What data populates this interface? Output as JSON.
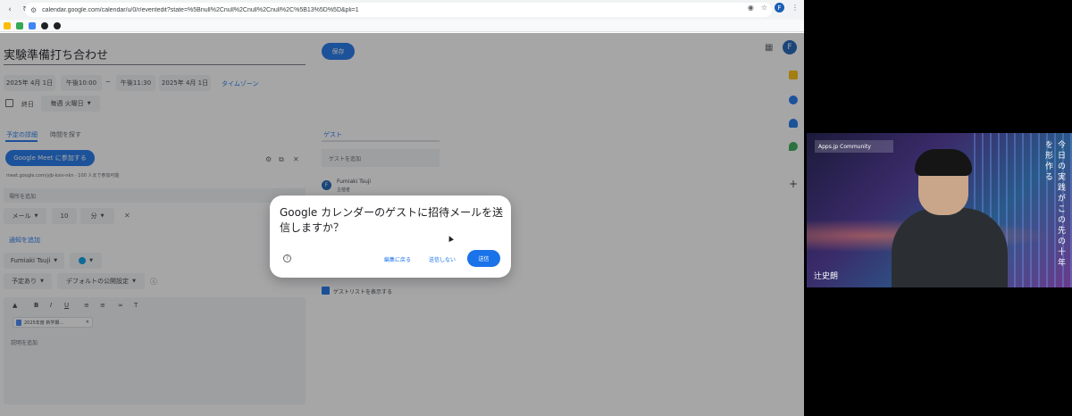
{
  "browser": {
    "url": "calendar.google.com/calendar/u/0/r/eventedit?state=%5Bnull%2Cnull%2Cnull%2Cnull%2C%5B13%5D%5D&pli=1",
    "profile_initial": "F"
  },
  "event": {
    "title": "実験準備打ち合わせ",
    "save_label": "保存",
    "start_date": "2025年 4月 1日",
    "start_time": "午後10:00",
    "separator": "~",
    "end_time": "午後11:30",
    "end_date": "2025年 4月 1日",
    "timezone_link": "タイムゾーン",
    "allday_label": "終日",
    "repeat_value": "毎週 火曜日",
    "tabs": [
      {
        "label": "予定の詳細",
        "active": true
      },
      {
        "label": "時間を探す",
        "active": false
      }
    ],
    "meet_button": "Google Meet に参加する",
    "meet_info": "meet.google.com/yjb-ksiv-nkn · 100 人まで参加可能",
    "location_placeholder": "場所を追加",
    "notification": {
      "type": "メール",
      "amount": "10",
      "unit": "分"
    },
    "add_notification": "通知を追加",
    "organizer": "Fumiaki Tsuji",
    "availability": "予定あり",
    "visibility": "デフォルトの公開設定",
    "attachment": "2025年度 新学期...",
    "description_placeholder": "説明を追加"
  },
  "guests": {
    "tab_label": "ゲスト",
    "add_placeholder": "ゲストを追加",
    "items": [
      {
        "initial": "F",
        "name": "Fumiaki Tsuji",
        "role": "主催者"
      }
    ],
    "show_list_label": "ゲストリストを表示する"
  },
  "dialog": {
    "title": "Google カレンダーのゲストに招待メールを送信しますか？",
    "help_icon": "?",
    "back_link": "編集に戻る",
    "no_send_link": "送信しない",
    "send_button": "送信"
  },
  "webcam": {
    "overlay_label": "Apps.jp Community",
    "vertical_text": "今日の実践がこの先の十年を形作る",
    "speaker_name": "辻史朗"
  },
  "colors": {
    "accent": "#1a73e8",
    "avatar": "#1a5fb4"
  }
}
